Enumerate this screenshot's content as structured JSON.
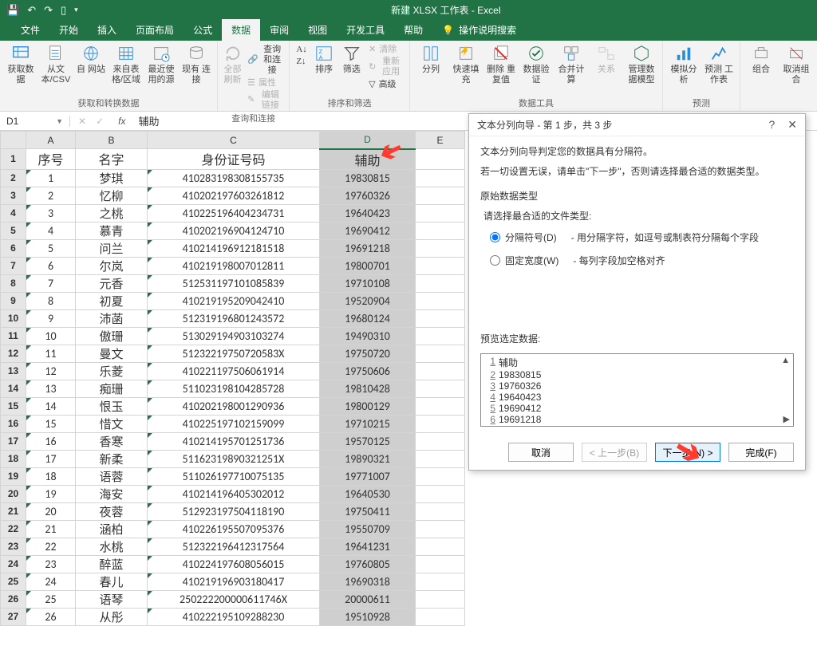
{
  "titlebar": {
    "title": "新建 XLSX 工作表  -  Excel"
  },
  "tabs": {
    "file": "文件",
    "home": "开始",
    "insert": "插入",
    "layout": "页面布局",
    "formula": "公式",
    "data": "数据",
    "review": "审阅",
    "view": "视图",
    "dev": "开发工具",
    "help": "帮助",
    "tell": "操作说明搜索"
  },
  "ribbon": {
    "get": {
      "label": "获取和转换数据",
      "get": "获取数\n据",
      "csv": "从文\n本/CSV",
      "web": "自\n网站",
      "table": "来自表\n格/区域",
      "recent": "最近使\n用的源",
      "conn": "现有\n连接"
    },
    "query": {
      "label": "查询和连接",
      "refresh": "全部刷新",
      "qc": "查询和连接",
      "prop": "属性",
      "editlink": "编辑链接"
    },
    "sort": {
      "label": "排序和筛选",
      "az": "A↓Z",
      "za": "Z↓A",
      "sort": "排序",
      "filter": "筛选",
      "clear": "清除",
      "reapply": "重新应用",
      "adv": "高级"
    },
    "tools": {
      "label": "数据工具",
      "split": "分列",
      "flash": "快速填充",
      "dedup": "删除\n重复值",
      "valid": "数据验\n证",
      "consol": "合并计算",
      "rel": "关系",
      "model": "管理数\n据模型"
    },
    "forecast": {
      "label": "预测",
      "whatif": "模拟分析",
      "predict": "预测\n工作表"
    },
    "group": {
      "group": "组合",
      "ungroup": "取消组合"
    }
  },
  "namebox": "D1",
  "formula": "辅助",
  "headers": {
    "A": "序号",
    "B": "名字",
    "C": "身份证号码",
    "D": "辅助"
  },
  "cols": [
    "A",
    "B",
    "C",
    "D",
    "E"
  ],
  "rows": [
    {
      "n": 1,
      "name": "梦琪",
      "id": "410283198308155735",
      "d": "19830815"
    },
    {
      "n": 2,
      "name": "忆柳",
      "id": "410202197603261812",
      "d": "19760326"
    },
    {
      "n": 3,
      "name": "之桃",
      "id": "410225196404234731",
      "d": "19640423"
    },
    {
      "n": 4,
      "name": "慕青",
      "id": "410202196904124710",
      "d": "19690412"
    },
    {
      "n": 5,
      "name": "问兰",
      "id": "410214196912181518",
      "d": "19691218"
    },
    {
      "n": 6,
      "name": "尔岚",
      "id": "410219198007012811",
      "d": "19800701"
    },
    {
      "n": 7,
      "name": "元香",
      "id": "512531197101085839",
      "d": "19710108"
    },
    {
      "n": 8,
      "name": "初夏",
      "id": "410219195209042410",
      "d": "19520904"
    },
    {
      "n": 9,
      "name": "沛菡",
      "id": "512319196801243572",
      "d": "19680124"
    },
    {
      "n": 10,
      "name": "傲珊",
      "id": "513029194903103274",
      "d": "19490310"
    },
    {
      "n": 11,
      "name": "曼文",
      "id": "51232219750720583X",
      "d": "19750720"
    },
    {
      "n": 12,
      "name": "乐菱",
      "id": "410221197506061914",
      "d": "19750606"
    },
    {
      "n": 13,
      "name": "痴珊",
      "id": "511023198104285728",
      "d": "19810428"
    },
    {
      "n": 14,
      "name": "恨玉",
      "id": "410202198001290936",
      "d": "19800129"
    },
    {
      "n": 15,
      "name": "惜文",
      "id": "410225197102159099",
      "d": "19710215"
    },
    {
      "n": 16,
      "name": "香寒",
      "id": "410214195701251736",
      "d": "19570125"
    },
    {
      "n": 17,
      "name": "新柔",
      "id": "51162319890321251X",
      "d": "19890321"
    },
    {
      "n": 18,
      "name": "语蓉",
      "id": "511026197710075135",
      "d": "19771007"
    },
    {
      "n": 19,
      "name": "海安",
      "id": "410214196405302012",
      "d": "19640530"
    },
    {
      "n": 20,
      "name": "夜蓉",
      "id": "512923197504118190",
      "d": "19750411"
    },
    {
      "n": 21,
      "name": "涵柏",
      "id": "410226195507095376",
      "d": "19550709"
    },
    {
      "n": 22,
      "name": "水桃",
      "id": "512322196412317564",
      "d": "19641231"
    },
    {
      "n": 23,
      "name": "醉蓝",
      "id": "410224197608056015",
      "d": "19760805"
    },
    {
      "n": 24,
      "name": "春儿",
      "id": "410219196903180417",
      "d": "19690318"
    },
    {
      "n": 25,
      "name": "语琴",
      "id": "250222200000611746X",
      "d": "20000611"
    },
    {
      "n": 26,
      "name": "从彤",
      "id": "410222195109288230",
      "d": "19510928"
    }
  ],
  "dialog": {
    "title": "文本分列向导 - 第 1 步，共 3 步",
    "line1": "文本分列向导判定您的数据具有分隔符。",
    "line2": "若一切设置无误，请单击\"下一步\"，否则请选择最合适的数据类型。",
    "section1": "原始数据类型",
    "prompt": "请选择最合适的文件类型:",
    "radio1": "分隔符号(D)",
    "radio1desc": "- 用分隔字符，如逗号或制表符分隔每个字段",
    "radio2": "固定宽度(W)",
    "radio2desc": "- 每列字段加空格对齐",
    "preview_label": "预览选定数据:",
    "preview": [
      "辅助",
      "19830815",
      "19760326",
      "19640423",
      "19690412",
      "19691218"
    ],
    "btn_cancel": "取消",
    "btn_back": "< 上一步(B)",
    "btn_next": "下一步(N) >",
    "btn_finish": "完成(F)"
  }
}
